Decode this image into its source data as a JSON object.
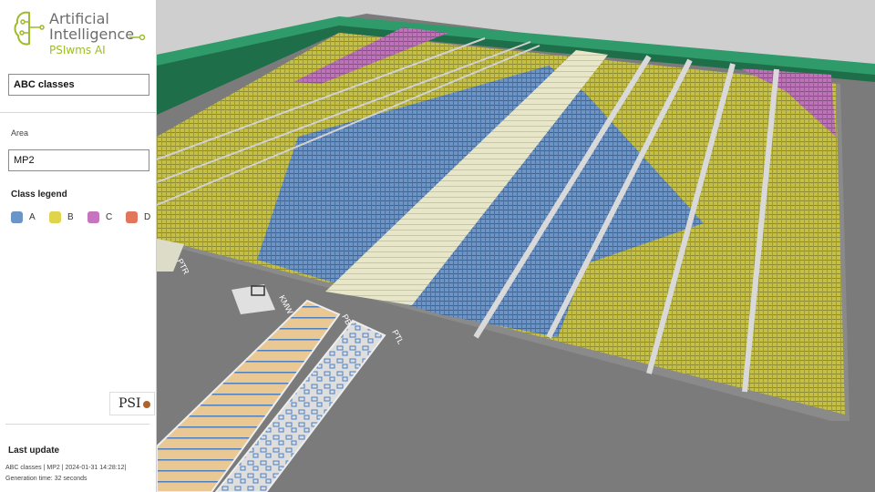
{
  "logo": {
    "title_line1": "Artificial",
    "title_line2": "Intelligence",
    "subtitle": "PSIwms AI",
    "icon": "brain-circuit-icon"
  },
  "analysis_select": {
    "value": "ABC classes"
  },
  "area": {
    "label": "Area",
    "value": "MP2"
  },
  "legend": {
    "title": "Class legend",
    "items": [
      {
        "label": "A",
        "color": "#6b94c7"
      },
      {
        "label": "B",
        "color": "#e0d44a"
      },
      {
        "label": "C",
        "color": "#c774c0"
      },
      {
        "label": "D",
        "color": "#e3755a"
      }
    ]
  },
  "company_logo": {
    "text": "PSI"
  },
  "last_update": {
    "title": "Last update",
    "line1": "ABC classes | MP2 | 2024-01-31 14:28:12|",
    "line2": "Generation time: 32 seconds"
  },
  "map_labels": {
    "ptr": "PTR",
    "kmw": "KMW",
    "pbr": "PBR",
    "ptl": "PTL"
  },
  "colors": {
    "floor": "#7a7a7a",
    "wall_green": "#2f9a6a",
    "blue_class": "#6b94c7",
    "yellow_class": "#c9c34a",
    "pink_class": "#c774c0",
    "aisle": "#dcdcd0",
    "staging_orange": "#e9c894",
    "staging_light": "#dcdcdc"
  }
}
